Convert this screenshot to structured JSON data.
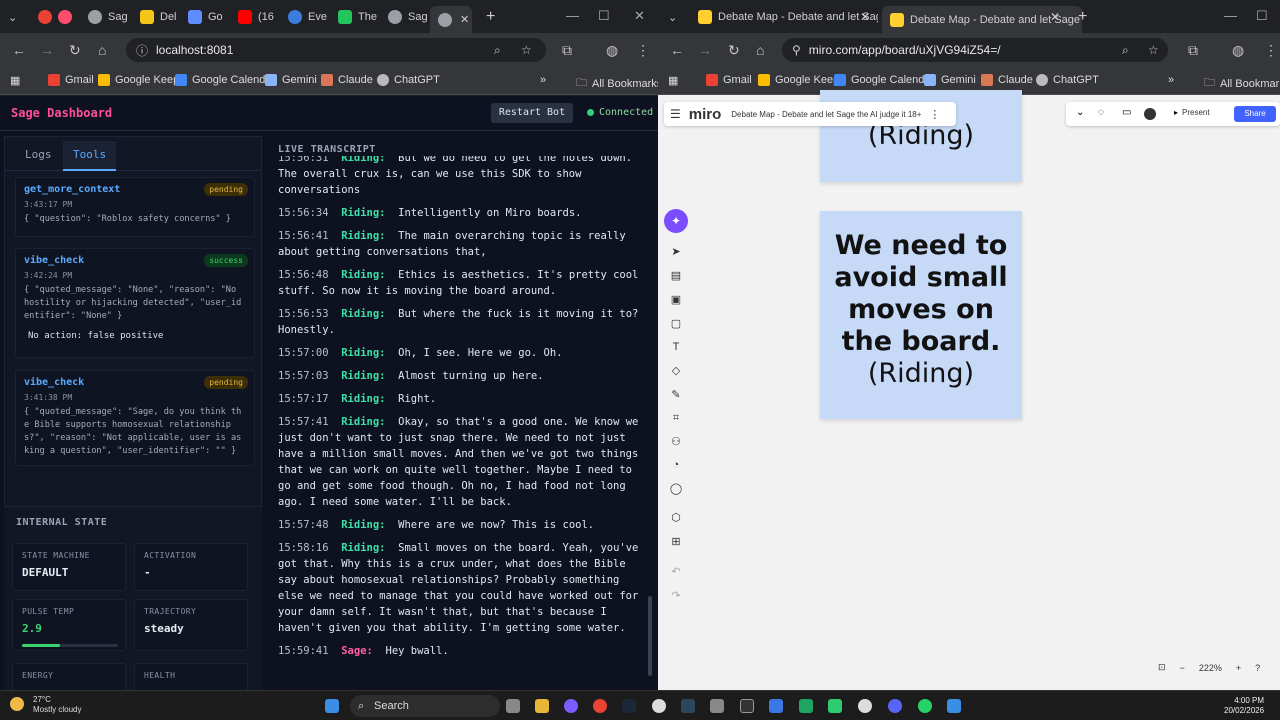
{
  "left_window": {
    "tabs": [
      "Sag",
      "Del",
      "Go",
      "(16",
      "Eve",
      "The",
      "Sag"
    ],
    "url": "localhost:8081",
    "bookmarks": [
      "Gmail",
      "Google Keep",
      "Google Calendar",
      "Gemini",
      "Claude",
      "ChatGPT"
    ],
    "all_bookmarks": "All Bookmarks"
  },
  "sage": {
    "title": "Sage Dashboard",
    "restart_label": "Restart Bot",
    "status": "Connected",
    "tabs": [
      "Logs",
      "Tools"
    ],
    "active_tab": "Tools",
    "tools": [
      {
        "name": "get_more_context",
        "status": "pending",
        "time": "3:43:17 PM",
        "args": "{ \"question\": \"Roblox safety concerns\" }",
        "note": ""
      },
      {
        "name": "vibe_check",
        "status": "success",
        "time": "3:42:24 PM",
        "args": "{ \"quoted_message\": \"None\", \"reason\": \"No hostility or hijacking detected\", \"user_identifier\": \"None\" }",
        "note": "No action: false positive"
      },
      {
        "name": "vibe_check",
        "status": "pending",
        "time": "3:41:38 PM",
        "args": "{ \"quoted_message\": \"Sage, do you think the Bible supports homosexual relationships?\", \"reason\": \"Not applicable, user is asking a question\", \"user_identifier\": \"\" }",
        "note": ""
      }
    ],
    "internal_state_title": "INTERNAL STATE",
    "state_cards": [
      {
        "label": "STATE MACHINE",
        "value": "DEFAULT"
      },
      {
        "label": "ACTIVATION",
        "value": "-"
      },
      {
        "label": "PULSE TEMP",
        "value": "2.9",
        "bar": 0.4
      },
      {
        "label": "TRAJECTORY",
        "value": "steady"
      },
      {
        "label": "ENERGY",
        "value": ""
      },
      {
        "label": "HEALTH",
        "value": ""
      }
    ],
    "transcript_title": "LIVE TRANSCRIPT",
    "transcript": [
      {
        "time": "15:56:31",
        "speaker": "Riding:",
        "text": "But we do need to get the notes down. The overall crux is, can we use this SDK to show conversations"
      },
      {
        "time": "15:56:34",
        "speaker": "Riding:",
        "text": "Intelligently on Miro boards."
      },
      {
        "time": "15:56:41",
        "speaker": "Riding:",
        "text": "The main overarching topic is really about getting conversations that,"
      },
      {
        "time": "15:56:48",
        "speaker": "Riding:",
        "text": "Ethics is aesthetics. It's pretty cool stuff. So now it is moving the board around."
      },
      {
        "time": "15:56:53",
        "speaker": "Riding:",
        "text": "But where the fuck is it moving it to? Honestly."
      },
      {
        "time": "15:57:00",
        "speaker": "Riding:",
        "text": "Oh, I see. Here we go. Oh."
      },
      {
        "time": "15:57:03",
        "speaker": "Riding:",
        "text": "Almost turning up here."
      },
      {
        "time": "15:57:17",
        "speaker": "Riding:",
        "text": "Right."
      },
      {
        "time": "15:57:41",
        "speaker": "Riding:",
        "text": "Okay, so that's a good one. We know we just don't want to just snap there. We need to not just have a million small moves. And then we've got two things that we can work on quite well together. Maybe I need to go and get some food though. Oh no, I had food not long ago. I need some water. I'll be back."
      },
      {
        "time": "15:57:48",
        "speaker": "Riding:",
        "text": "Where are we now? This is cool."
      },
      {
        "time": "15:58:16",
        "speaker": "Riding:",
        "text": "Small moves on the board. Yeah, you've got that. Why this is a crux under, what does the Bible say about homosexual relationships? Probably something else we need to manage that you could have worked out for your damn self. It wasn't that, but that's because I haven't given you that ability. I'm getting some water."
      },
      {
        "time": "15:59:41",
        "speaker": "Sage:",
        "text": "Hey bwall."
      }
    ]
  },
  "right_window": {
    "tabs": [
      "Debate Map - Debate and let Sage the",
      "Debate Map - Debate and let Sage th"
    ],
    "url": "miro.com/app/board/uXjVG94iZ54=/",
    "bookmarks": [
      "Gmail",
      "Google Keep",
      "Google Calendar",
      "Gemini",
      "Claude",
      "ChatGPT"
    ],
    "all_bookmarks": "All Bookmarks"
  },
  "miro": {
    "logo": "miro",
    "board_title": "Debate Map - Debate and let Sage the AI judge it 18+",
    "present": "Present",
    "share": "Share",
    "sticky_top_text": "(Riding)",
    "sticky_main_bold": "We need to avoid small moves on the board.",
    "sticky_main_author": "(Riding)",
    "zoom": "222%"
  },
  "taskbar": {
    "temp": "27°C",
    "weather": "Mostly cloudy",
    "search": "Search",
    "time": "4:00 PM",
    "date": "20/02/2026"
  }
}
